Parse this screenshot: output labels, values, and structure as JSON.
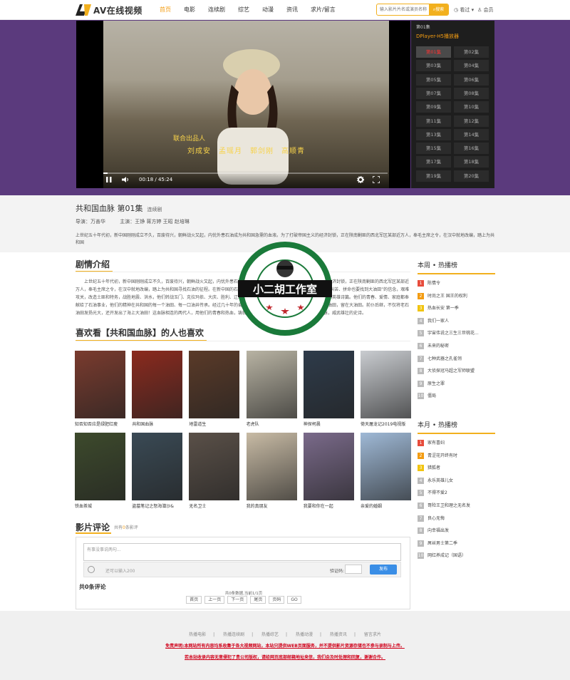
{
  "header": {
    "logo_text": "AV在线视频",
    "nav": [
      "首页",
      "电影",
      "连续剧",
      "综艺",
      "动漫",
      "资讯",
      "求片/留言"
    ],
    "nav_active": 0,
    "search_placeholder": "输入影片片名或演员名称",
    "search_button": "搜索",
    "history_label": "看过",
    "member_label": "会员"
  },
  "player": {
    "subtitle_line1": "联合出品人",
    "subtitle_line2": "刘成安　孟瑶月　郭剑刚　高顺青",
    "time": "00:18 / 45:24",
    "progress": 0.0066
  },
  "playlist": {
    "title": "第01集",
    "source": "DPlayer-H5播放器",
    "episodes": [
      "第01集",
      "第02集",
      "第03集",
      "第04集",
      "第05集",
      "第06集",
      "第07集",
      "第08集",
      "第09集",
      "第10集",
      "第11集",
      "第12集",
      "第13集",
      "第14集",
      "第15集",
      "第16集",
      "第17集",
      "第18集",
      "第19集",
      "第20集"
    ],
    "active": 0
  },
  "info": {
    "title": "共和国血脉 第01集",
    "category": "连续剧",
    "director_label": "导演：",
    "director": "万善华",
    "actors_label": "主演：",
    "actors": "王铮 蒋方婷 王昭 赵培琳",
    "description": "上世纪五十年代初，新中国刚刚成立不久，百废待兴，朝鲜战火又起，内忧外患石油成为共和国急需的血液。为了打破帝国主义的经济封锁，正在陕南剿匪的西北军区某部近万人，奉毛主席之令，在汉中就地改编，踏上为共和国"
  },
  "plot": {
    "heading": "剧情介绍",
    "text": "上世纪五十年代初，新中国刚刚成立不久，百废待兴，朝鲜战火又起，内忧外患石油成为共和国急需的血液。为了打破帝国主义的经济封锁，正在陕南剿匪的西北军区某部近万人，奉毛主席之令，在汉中就地改编，踏上为共和国寻找石油的征程。在新中国的石油战线上，他们克服重重困难，怀着“流血流汗不叫苦、拼命也要找到大油田”的信念，艰难攻关，改造土匪和特务，战胜地震、洪水，他们转战玉门、克拉玛依、大庆、胜利、辽河、大港等油田，用青春和热血谱写了可歌可泣的英雄诗篇。他们的青春、爱情、家庭都奉献给了石油事业，他们的精神在共和国的每一个油田、每一口油井传承。经过几十年的奋斗，在西北、华北、东北建成大油田，长在大油田，留在大油田。前仆后继，不仅将老石油田发扬光大，还开发出了海上大油田！这血脉相连的两代人，用他们的青春和热血，铸就了共和国的石油脊梁，铸就了共和国的血脉，威武雄壮的史诗。"
  },
  "related": {
    "heading": "喜欢看【共和国血脉】的人也喜欢",
    "items": [
      {
        "title": "知否知否应是绿肥红瘦",
        "color": "#7a3b2e"
      },
      {
        "title": "共和国血脉",
        "color": "#8b2a1e"
      },
      {
        "title": "地雷道生",
        "color": "#5a3a28"
      },
      {
        "title": "老虎队",
        "color": "#b8b3a3"
      },
      {
        "title": "神探柯晨",
        "color": "#2e3b4a"
      },
      {
        "title": "倚天屠龙记2019电视版",
        "color": "#c9ccd0"
      },
      {
        "title": "铁血茶城",
        "color": "#3d4a2c"
      },
      {
        "title": "盗墓笔记之怒海潜沙&",
        "color": "#3a4a55"
      },
      {
        "title": "无名卫士",
        "color": "#5a5048"
      },
      {
        "title": "我的真朋友",
        "color": "#c8bba5"
      },
      {
        "title": "我要和你在一起",
        "color": "#7a6a8a"
      },
      {
        "title": "亲爱的婚姻",
        "color": "#9fb9d6"
      }
    ]
  },
  "week_rank": {
    "heading": "本周 • 热播榜",
    "items": [
      "陈情令",
      "时尚之王 国王的权利",
      "热血长安 第一季",
      "我们一家人",
      "宇宙伟说之三生三世桃花...",
      "未来的秘密",
      "七种武器之孔雀翎",
      "大侦探冠马超之军师联盟",
      "原生之罪",
      "僵局"
    ]
  },
  "month_rank": {
    "heading": "本月 • 热播榜",
    "items": [
      "家有喜妇",
      "青涩花开终有时",
      "猎狐者",
      "永乐英雄儿女",
      "不得不爱2",
      "哥险王卫和理之无名发",
      "良心无悔",
      "向幸福出发",
      "屌丝男士第二季",
      "网红养成记（国语）"
    ]
  },
  "comments": {
    "heading": "影片评论",
    "sub_prefix": "共有",
    "sub_count": "0",
    "sub_suffix": "条影评",
    "placeholder": "有事没事说两句...",
    "limit": "还可以输入200",
    "verify_label": "验证码:",
    "submit": "发布",
    "count_text": "共0条评论",
    "page_info": "共0条数据,当前1/1页",
    "pager": [
      "首页",
      "上一页",
      "下一页",
      "尾页",
      "页码",
      "GO"
    ]
  },
  "footer": {
    "links": [
      "热播电影",
      "热播连续剧",
      "热播综艺",
      "热播动漫",
      "热播资讯",
      "留言求片"
    ],
    "note1": "免责声明:本网站所有内容均系收集于各大视频网站，本站只提供WEB页面服务，并不提供影片资源存储也不参与录制与上传。",
    "note2": "若本站收录内容无意侵犯了贵公司版权，请给网页底部邮箱地址来信，我们会及时处理和回复，谢谢合作。"
  },
  "watermark": {
    "top_text": "专注资源分享",
    "center_text": "小二胡工作室",
    "bottom_text": "www.xiaoerhu.com"
  },
  "colors": {
    "accent": "#f2b01e",
    "band": "#5b3a7d",
    "episode_active": "#ff3333",
    "note": "#d0021b"
  }
}
